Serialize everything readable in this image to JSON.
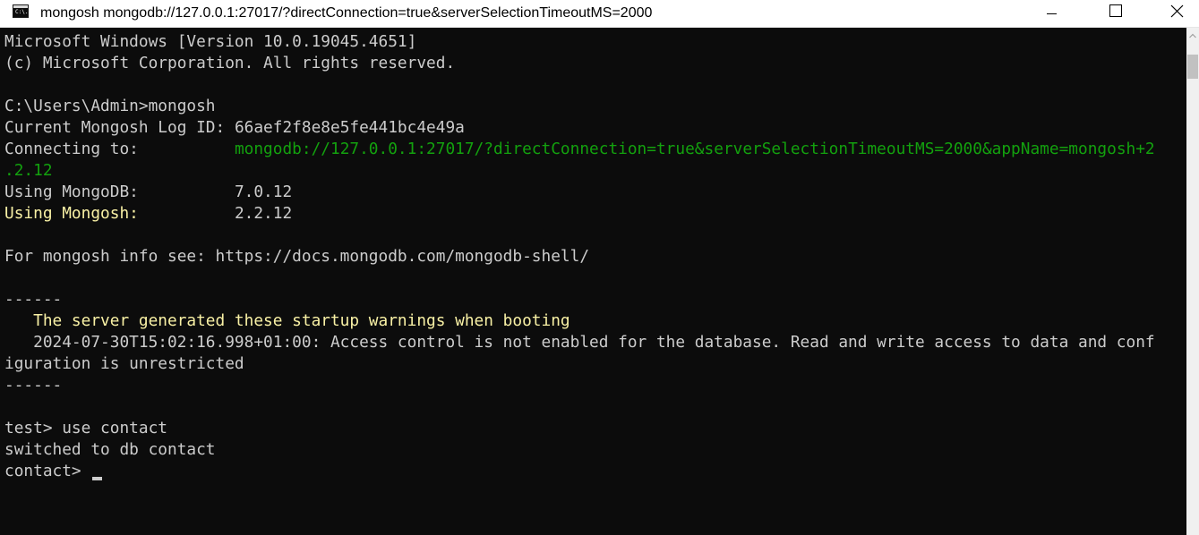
{
  "window": {
    "title": "mongosh mongodb://127.0.0.1:27017/?directConnection=true&serverSelectionTimeoutMS=2000",
    "icon_glyph": "C:\\.",
    "icons": {
      "app": "cmd-icon",
      "minimize": "minimize-icon",
      "maximize": "maximize-icon",
      "close": "close-icon"
    }
  },
  "console": {
    "colors": {
      "background": "#0c0c0c",
      "text": "#cccccc",
      "green": "#13a10e",
      "yellow": "#f9f1a5"
    },
    "header_line_1": "Microsoft Windows [Version 10.0.19045.4651]",
    "header_line_2": "(c) Microsoft Corporation. All rights reserved.",
    "prompt_cmd": "C:\\Users\\Admin>mongosh",
    "log_id_label": "Current Mongosh Log ID: ",
    "log_id_value": "66aef2f8e8e5fe441bc4e49a",
    "connecting_label": "Connecting to:          ",
    "connecting_value_1": "mongodb://127.0.0.1:27017/?directConnection=true&serverSelectionTimeoutMS=2000&appName=mongosh+2",
    "connecting_value_2": ".2.12",
    "mongodb_label": "Using MongoDB:          ",
    "mongodb_value": "7.0.12",
    "mongosh_label": "Using Mongosh:",
    "mongosh_pad": "          ",
    "mongosh_value": "2.2.12",
    "info_line": "For mongosh info see: https://docs.mongodb.com/mongodb-shell/",
    "separator": "------",
    "warning_heading": "   The server generated these startup warnings when booting",
    "warning_line_1": "   2024-07-30T15:02:16.998+01:00: Access control is not enabled for the database. Read and write access to data and conf",
    "warning_line_2": "iguration is unrestricted",
    "cmd_use": "test> use contact",
    "switched": "switched to db contact",
    "current_prompt": "contact> "
  }
}
